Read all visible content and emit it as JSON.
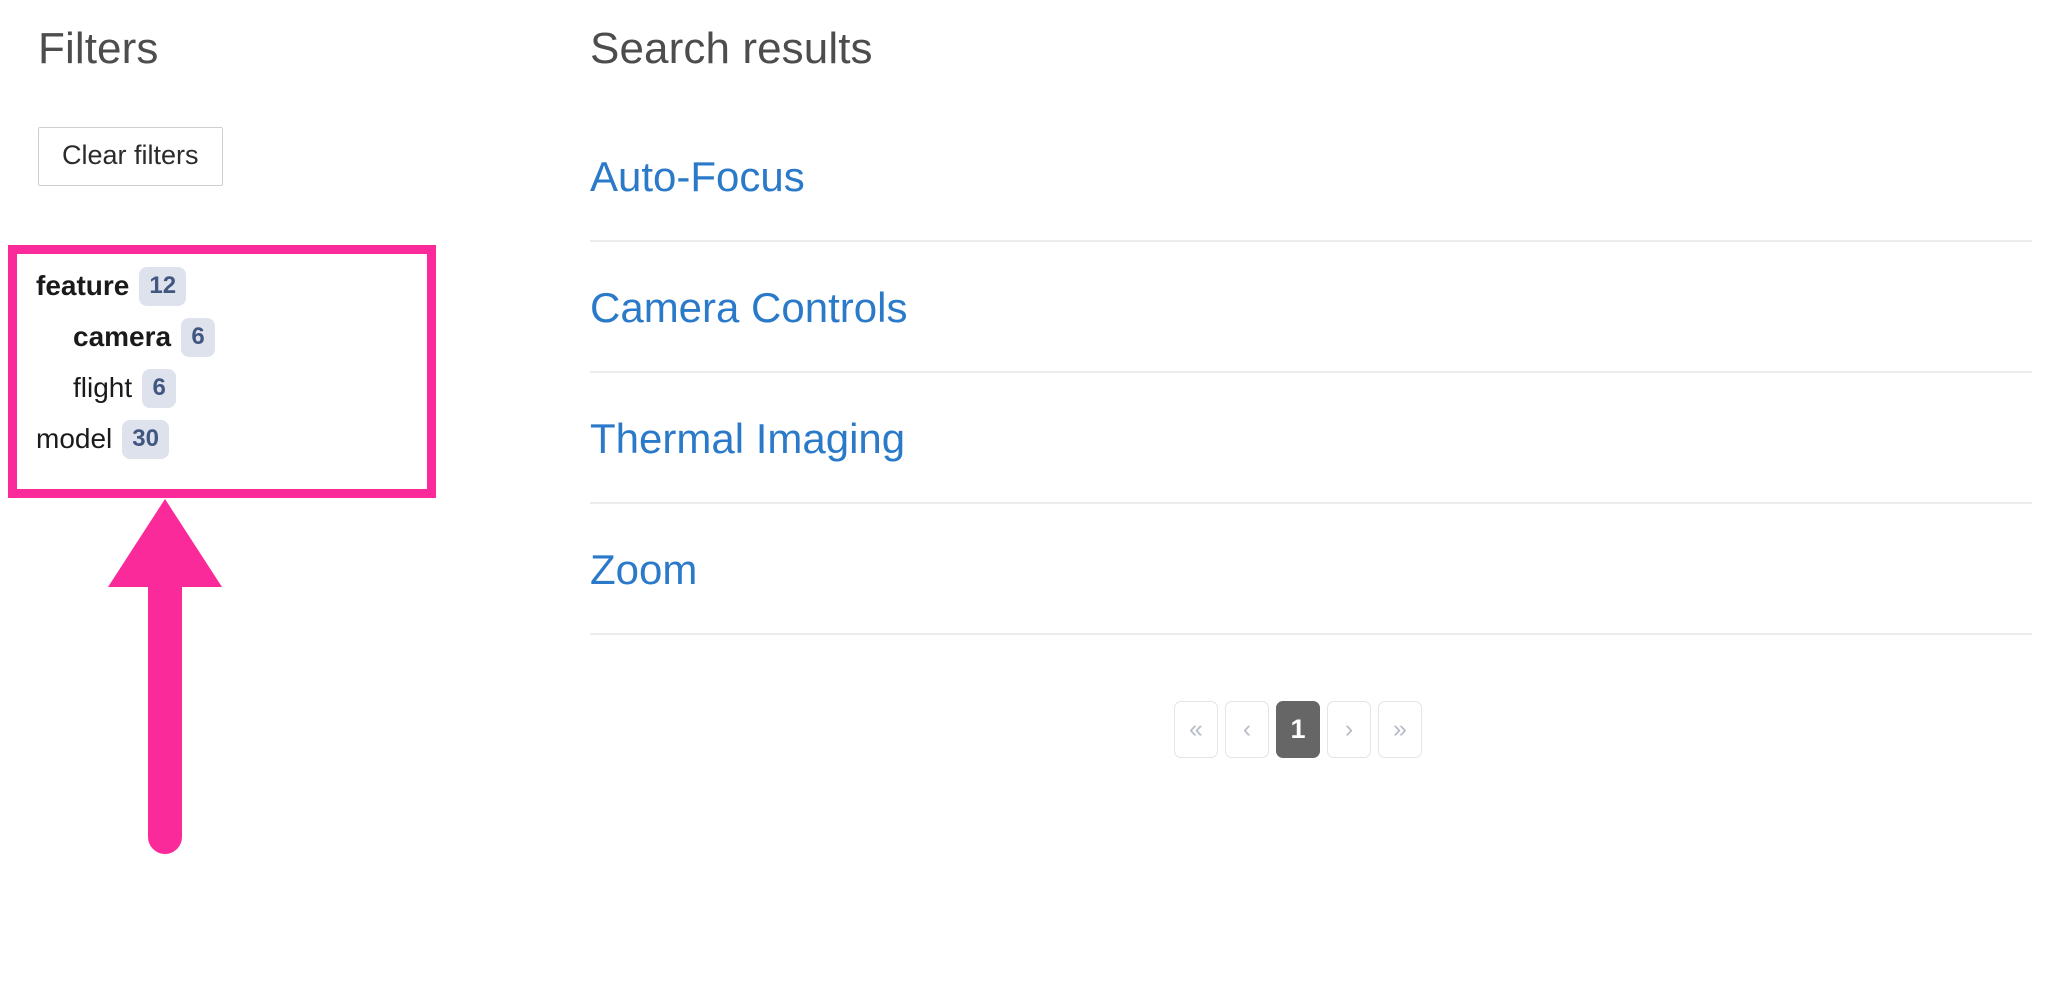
{
  "filters": {
    "heading": "Filters",
    "clear_button_label": "Clear filters",
    "facets": [
      {
        "label": "feature",
        "count": "12",
        "level": 0,
        "bold": true
      },
      {
        "label": "camera",
        "count": "6",
        "level": 1,
        "bold": true
      },
      {
        "label": "flight",
        "count": "6",
        "level": 1,
        "bold": false
      },
      {
        "label": "model",
        "count": "30",
        "level": 0,
        "bold": false
      }
    ]
  },
  "results": {
    "heading": "Search results",
    "items": [
      {
        "title": "Auto-Focus"
      },
      {
        "title": "Camera Controls"
      },
      {
        "title": "Thermal Imaging"
      },
      {
        "title": "Zoom"
      }
    ]
  },
  "pagination": {
    "first_label": "«",
    "prev_label": "‹",
    "current_page": "1",
    "next_label": "›",
    "last_label": "»"
  },
  "annotation": {
    "highlight_color": "#fb2a9a",
    "arrow_color": "#fb2a9a",
    "arrow_icon": "up-arrow-annotation"
  },
  "colors": {
    "link": "#2b7ac9",
    "heading": "#4d4d4d",
    "badge_bg": "#dee2ed",
    "badge_text": "#41577f",
    "active_page_bg": "#666666"
  }
}
